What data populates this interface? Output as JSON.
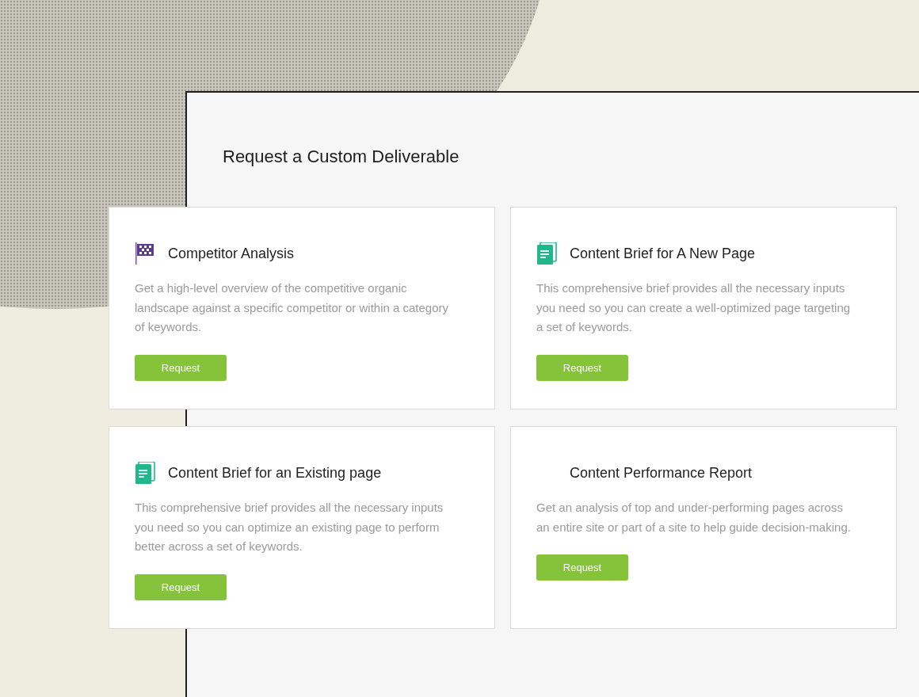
{
  "heading": "Request a Custom Deliverable",
  "cards": [
    {
      "kind": "flag",
      "title": "Competitor Analysis",
      "description": "Get a high-level overview of the competitive organic landscape against a specific competitor or within a category of keywords.",
      "button": "Request"
    },
    {
      "kind": "document",
      "title": "Content Brief for A New Page",
      "description": "This comprehensive brief provides all the necessary inputs you need so you can create a well-optimized page targeting a set of keywords.",
      "button": "Request"
    },
    {
      "kind": "document",
      "title": "Content Brief for an Existing page",
      "description": "This comprehensive brief provides all the necessary inputs you need so you can optimize an existing page to perform better across a set of keywords.",
      "button": "Request"
    },
    {
      "kind": "plain",
      "title": "Content Performance Report",
      "description": "Get an analysis of top and under-performing pages across an entire site or part of a site to help guide decision-making.",
      "button": "Request"
    }
  ]
}
